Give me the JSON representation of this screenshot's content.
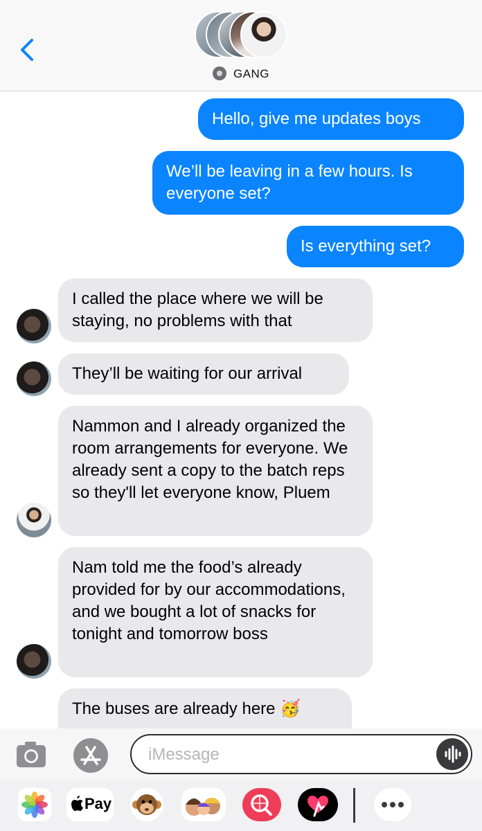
{
  "header": {
    "group_name": "GANG",
    "back_icon": "chevron-left-icon",
    "accent": "#0a84ff"
  },
  "messages": [
    {
      "dir": "out",
      "text": "Hello, give me updates boys"
    },
    {
      "dir": "out",
      "text": "We’ll be leaving in a few hours. Is everyone set?"
    },
    {
      "dir": "out",
      "text": "Is everything set?"
    },
    {
      "dir": "in",
      "text": "I called the place where we will be staying, no problems with that"
    },
    {
      "dir": "in",
      "text": "They’ll be waiting for our arrival"
    },
    {
      "dir": "in",
      "text": "Nammon and I already organized the room arrangements for everyone. We already sent a copy to the batch reps so they'll let everyone know, Pluem"
    },
    {
      "dir": "in",
      "text": "Nam told me the food’s already provided for by our accommodations, and we bought a lot of snacks for tonight and tomorrow boss"
    },
    {
      "dir": "in",
      "text": "The buses are already here 🥳"
    }
  ],
  "input": {
    "placeholder": "iMessage",
    "value": ""
  },
  "app_drawer": {
    "apple_pay_label": "Pay",
    "items": [
      "photos-icon",
      "apple-pay-icon",
      "monkey-memoji-icon",
      "memoji-stickers-icon",
      "image-search-icon",
      "digital-touch-icon",
      "more-icon"
    ]
  },
  "colors": {
    "outgoing_bubble": "#0a84ff",
    "incoming_bubble": "#e9e9eb"
  }
}
